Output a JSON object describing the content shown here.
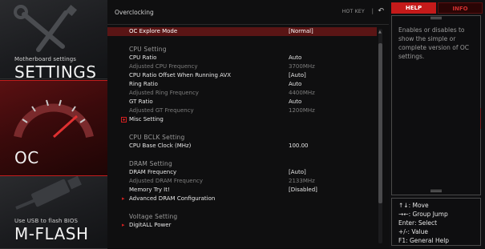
{
  "sidebar": {
    "settings": {
      "small": "Motherboard settings",
      "big": "SETTINGS"
    },
    "oc": {
      "big": "OC"
    },
    "mflash": {
      "small": "Use USB to flash BIOS",
      "big": "M-FLASH"
    }
  },
  "header": {
    "breadcrumb": "Overclocking",
    "hotkey": "HOT KEY",
    "separator": "|",
    "back_icon": "back-arrow-icon"
  },
  "rows": [
    {
      "label": "OC Explore Mode",
      "value": "[Normal]",
      "kind": "selected"
    },
    {
      "label": "CPU  Setting",
      "value": "",
      "kind": "header"
    },
    {
      "label": "CPU Ratio",
      "value": "Auto",
      "kind": "item"
    },
    {
      "label": "Adjusted CPU Frequency",
      "value": "3700MHz",
      "kind": "dim"
    },
    {
      "label": "CPU Ratio Offset When Running AVX",
      "value": "[Auto]",
      "kind": "item"
    },
    {
      "label": "Ring Ratio",
      "value": "Auto",
      "kind": "item"
    },
    {
      "label": "Adjusted Ring Frequency",
      "value": "4400MHz",
      "kind": "dim"
    },
    {
      "label": "GT Ratio",
      "value": "Auto",
      "kind": "item"
    },
    {
      "label": "Adjusted GT Frequency",
      "value": "1200MHz",
      "kind": "dim"
    },
    {
      "label": "Misc Setting",
      "value": "",
      "kind": "expand"
    },
    {
      "label": "CPU  BCLK  Setting",
      "value": "",
      "kind": "header"
    },
    {
      "label": "CPU Base Clock (MHz)",
      "value": "100.00",
      "kind": "item"
    },
    {
      "label": "DRAM  Setting",
      "value": "",
      "kind": "header"
    },
    {
      "label": "DRAM Frequency",
      "value": "[Auto]",
      "kind": "item"
    },
    {
      "label": "Adjusted DRAM Frequency",
      "value": "2133MHz",
      "kind": "dim"
    },
    {
      "label": "Memory Try It!",
      "value": "[Disabled]",
      "kind": "item"
    },
    {
      "label": "Advanced DRAM Configuration",
      "value": "",
      "kind": "submenu"
    },
    {
      "label": "Voltage  Setting",
      "value": "",
      "kind": "header"
    },
    {
      "label": "DigitALL Power",
      "value": "",
      "kind": "submenu"
    }
  ],
  "help": {
    "tab_help": "HELP",
    "tab_info": "INFO",
    "text": "Enables or disables to show the simple or complete version of OC settings.",
    "keys": [
      "↑↓: Move",
      "→←: Group Jump",
      "Enter: Select",
      "+/-: Value",
      "F1: General Help"
    ]
  },
  "colors": {
    "accent": "#c41a1a",
    "selected_row": "#5a1515",
    "dim_text": "#7d7d7d"
  }
}
